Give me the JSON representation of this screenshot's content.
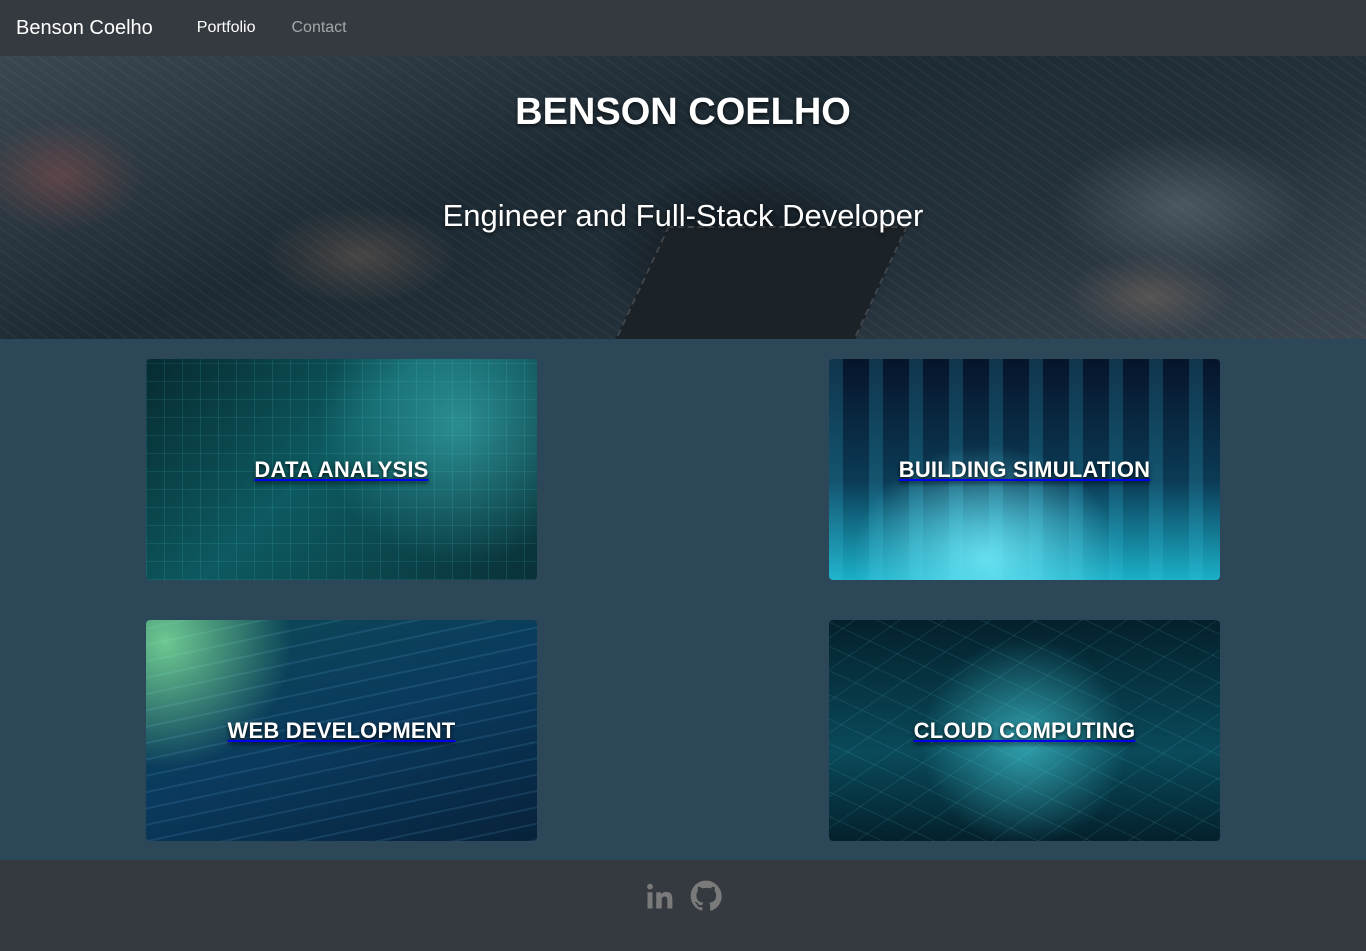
{
  "navbar": {
    "brand": "Benson Coelho",
    "links": [
      {
        "label": "Portfolio"
      },
      {
        "label": "Contact"
      }
    ]
  },
  "hero": {
    "title": "BENSON COELHO",
    "subtitle": "Engineer and Full-Stack Developer"
  },
  "cards": [
    {
      "label": "DATA ANALYSIS"
    },
    {
      "label": "BUILDING SIMULATION"
    },
    {
      "label": "WEB DEVELOPMENT"
    },
    {
      "label": "CLOUD COMPUTING"
    }
  ],
  "footer": {
    "icons": [
      "linkedin-icon",
      "github-icon"
    ]
  }
}
